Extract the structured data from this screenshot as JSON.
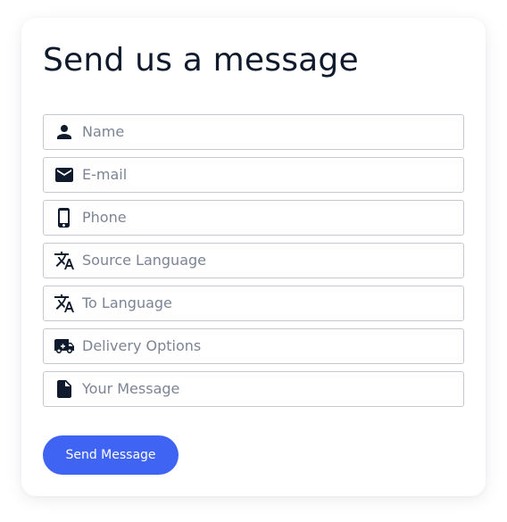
{
  "form": {
    "title": "Send us a message",
    "fields": [
      {
        "placeholder": "Name",
        "icon": "person-icon",
        "value": ""
      },
      {
        "placeholder": "E-mail",
        "icon": "envelope-icon",
        "value": ""
      },
      {
        "placeholder": "Phone",
        "icon": "phone-icon",
        "value": ""
      },
      {
        "placeholder": "Source Language",
        "icon": "translate-icon",
        "value": ""
      },
      {
        "placeholder": "To Language",
        "icon": "translate-icon",
        "value": ""
      },
      {
        "placeholder": "Delivery Options",
        "icon": "truck-icon",
        "value": ""
      },
      {
        "placeholder": "Your Message",
        "icon": "document-icon",
        "value": ""
      }
    ],
    "submit_label": "Send Message"
  },
  "colors": {
    "accent": "#3f64f4",
    "title": "#0f1b2d",
    "field_border": "#c4c9d0",
    "placeholder": "#7c8494",
    "icon": "#0f1b2d"
  }
}
